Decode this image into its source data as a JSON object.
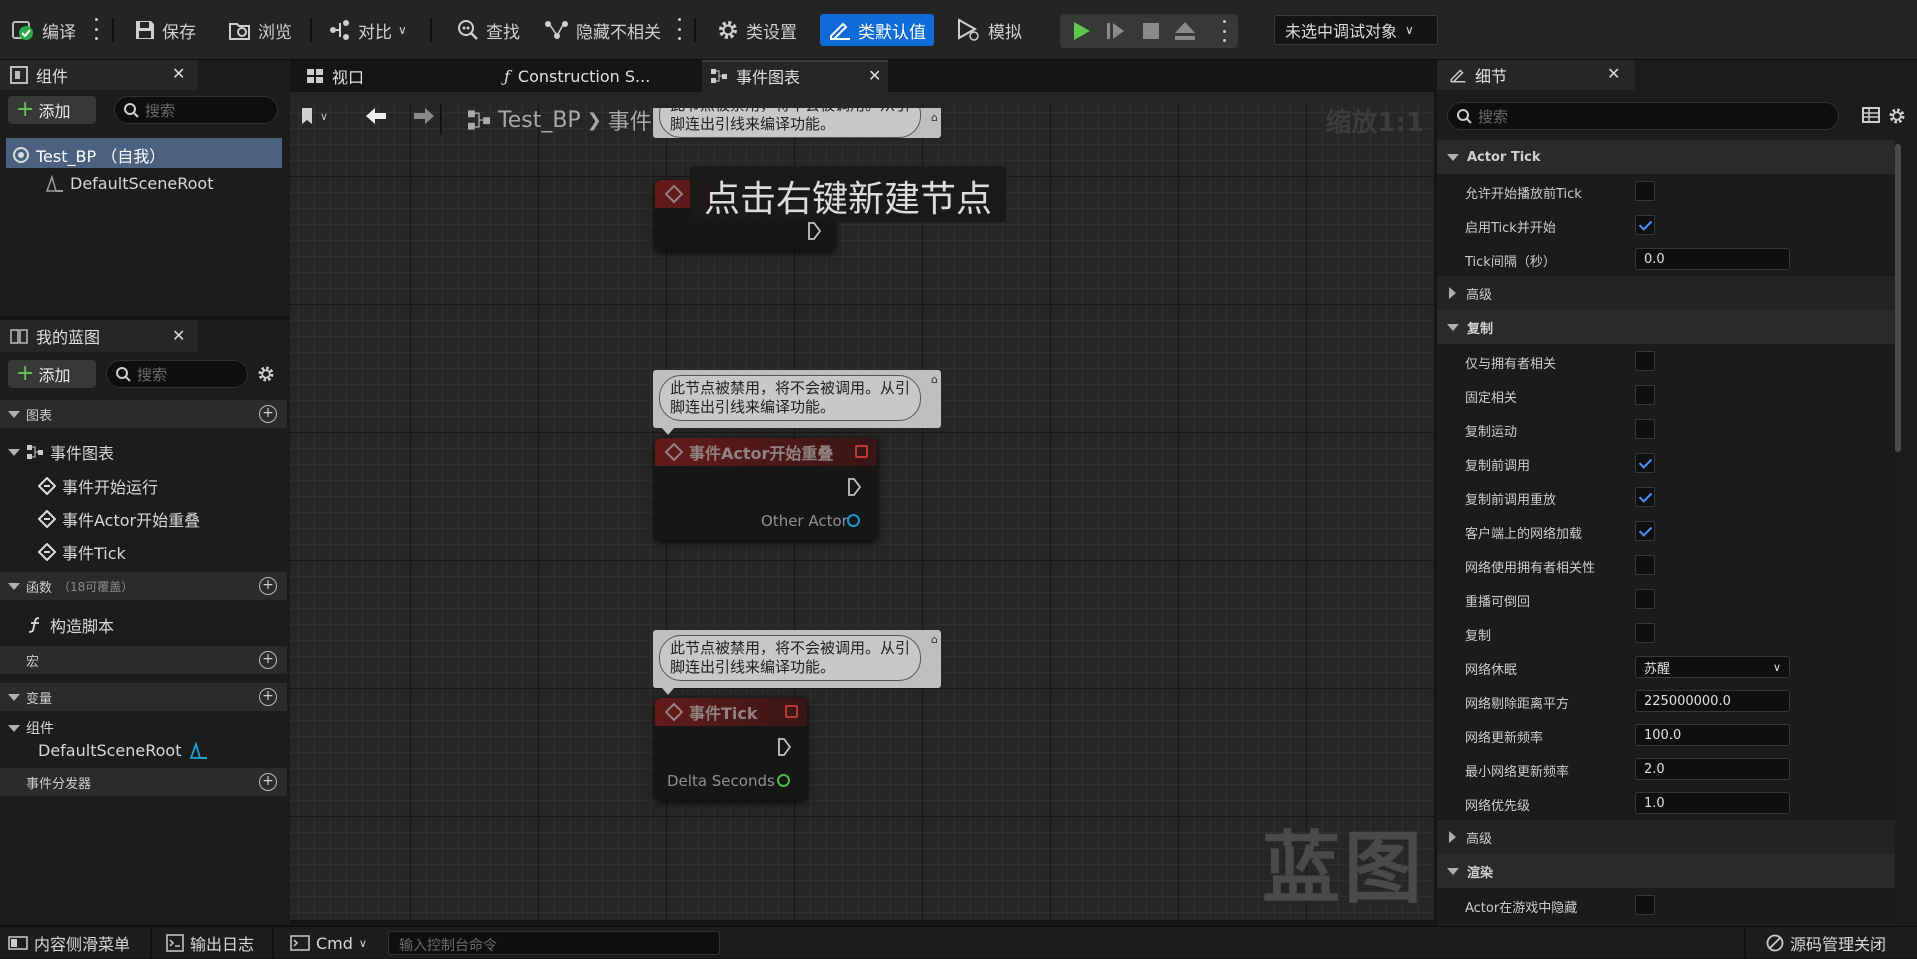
{
  "toolbar": {
    "compile": "编译",
    "save": "保存",
    "browse": "浏览",
    "diff": "对比",
    "find": "查找",
    "hide_unrelated": "隐藏不相关",
    "class_settings": "类设置",
    "class_defaults": "类默认值",
    "simulate": "模拟",
    "debug_target": "未选中调试对象"
  },
  "components_panel": {
    "title": "组件",
    "add": "添加",
    "search_placeholder": "搜索",
    "root": "Test_BP （自我）",
    "child": "DefaultSceneRoot"
  },
  "my_blueprint": {
    "title": "我的蓝图",
    "add": "添加",
    "search_placeholder": "搜索",
    "graphs_header": "图表",
    "event_graph": "事件图表",
    "events": [
      "事件开始运行",
      "事件Actor开始重叠",
      "事件Tick"
    ],
    "functions_header": "函数",
    "functions_override": "（18可覆盖）",
    "construction_script": "构造脚本",
    "macros_header": "宏",
    "variables_header": "变量",
    "components_group": "组件",
    "component_var": "DefaultSceneRoot",
    "dispatchers_header": "事件分发器"
  },
  "tabs": {
    "viewport": "视口",
    "construction": "Construction S...",
    "event_graph": "事件图表"
  },
  "graph": {
    "breadcrumb_bp": "Test_BP",
    "breadcrumb_graph": "事件图表",
    "zoom": "缩放1:1",
    "hint": "点击右键新建节点",
    "watermark": "蓝图",
    "comment_text": "此节点被禁用，将不会被调用。从引脚连出引线来编译功能。",
    "node_overlap_title": "事件Actor开始重叠",
    "node_overlap_pin": "Other Actor",
    "node_tick_title": "事件Tick",
    "node_tick_pin": "Delta Seconds"
  },
  "details": {
    "title": "细节",
    "search_placeholder": "搜索",
    "section_tick": "Actor Tick",
    "tick_rows": [
      {
        "label": "允许开始播放前Tick",
        "type": "check",
        "value": false
      },
      {
        "label": "启用Tick并开始",
        "type": "check",
        "value": true
      },
      {
        "label": "Tick间隔（秒）",
        "type": "number",
        "value": "0.0"
      }
    ],
    "advanced": "高级",
    "section_replication": "复制",
    "rep_rows": [
      {
        "label": "仅与拥有者相关",
        "type": "check",
        "value": false
      },
      {
        "label": "固定相关",
        "type": "check",
        "value": false
      },
      {
        "label": "复制运动",
        "type": "check",
        "value": false
      },
      {
        "label": "复制前调用",
        "type": "check",
        "value": true
      },
      {
        "label": "复制前调用重放",
        "type": "check",
        "value": true
      },
      {
        "label": "客户端上的网络加载",
        "type": "check",
        "value": true
      },
      {
        "label": "网络使用拥有者相关性",
        "type": "check",
        "value": false
      },
      {
        "label": "重播可倒回",
        "type": "check",
        "value": false
      },
      {
        "label": "复制",
        "type": "check",
        "value": false
      },
      {
        "label": "网络休眠",
        "type": "select",
        "value": "苏醒"
      },
      {
        "label": "网络剔除距离平方",
        "type": "number",
        "value": "225000000.0"
      },
      {
        "label": "网络更新频率",
        "type": "number",
        "value": "100.0"
      },
      {
        "label": "最小网络更新频率",
        "type": "number",
        "value": "2.0"
      },
      {
        "label": "网络优先级",
        "type": "number",
        "value": "1.0"
      }
    ],
    "advanced2": "高级",
    "section_render": "渲染",
    "render_row": {
      "label": "Actor在游戏中隐藏",
      "type": "check",
      "value": false
    }
  },
  "status": {
    "content_drawer": "内容侧滑菜单",
    "output_log": "输出日志",
    "cmd": "Cmd",
    "console_placeholder": "输入控制台命令",
    "source_control": "源码管理关闭"
  },
  "colors": {
    "accent": "#0e6bd8",
    "play_green": "#5ec84e",
    "exec_red": "#c83a3a",
    "object_pin": "#1aa3d8",
    "float_pin": "#52c84a"
  }
}
